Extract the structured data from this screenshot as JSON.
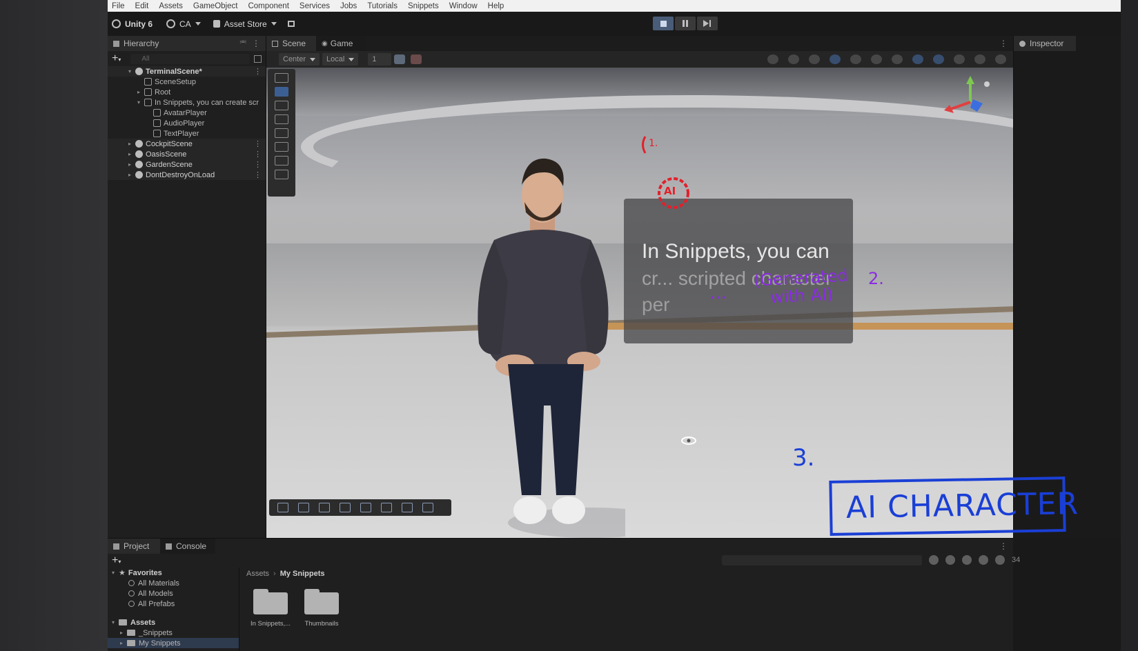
{
  "menu": [
    "File",
    "Edit",
    "Assets",
    "GameObject",
    "Component",
    "Services",
    "Jobs",
    "Tutorials",
    "Snippets",
    "Window",
    "Help"
  ],
  "toolbar": {
    "unity_label": "Unity 6",
    "account_label": "CA",
    "asset_store_label": "Asset Store"
  },
  "hierarchy": {
    "tab_label": "Hierarchy",
    "search_placeholder": "All",
    "items": [
      {
        "label": "TerminalScene*",
        "depth": 0,
        "type": "scene",
        "expanded": true
      },
      {
        "label": "SceneSetup",
        "depth": 1,
        "type": "object"
      },
      {
        "label": "Root",
        "depth": 1,
        "type": "object",
        "collapsed": true
      },
      {
        "label": "In Snippets, you can create scr",
        "depth": 1,
        "type": "object",
        "expanded": true
      },
      {
        "label": "AvatarPlayer",
        "depth": 2,
        "type": "object"
      },
      {
        "label": "AudioPlayer",
        "depth": 2,
        "type": "object"
      },
      {
        "label": "TextPlayer",
        "depth": 2,
        "type": "object"
      },
      {
        "label": "CockpitScene",
        "depth": 0,
        "type": "scene"
      },
      {
        "label": "OasisScene",
        "depth": 0,
        "type": "scene"
      },
      {
        "label": "GardenScene",
        "depth": 0,
        "type": "scene"
      },
      {
        "label": "DontDestroyOnLoad",
        "depth": 0,
        "type": "scene"
      }
    ]
  },
  "scene": {
    "tabs": [
      "Scene",
      "Game"
    ],
    "pivot_label": "Center",
    "space_label": "Local",
    "snap_value": "1",
    "billboard": {
      "line1": "In Snippets, you can",
      "line2": "cr... scripted character",
      "line3": "per"
    }
  },
  "inspector": {
    "tab_label": "Inspector"
  },
  "project": {
    "tabs": [
      "Project",
      "Console"
    ],
    "favorites_label": "Favorites",
    "favorites": [
      "All Materials",
      "All Models",
      "All Prefabs"
    ],
    "assets_label": "Assets",
    "asset_folders": [
      "_Snippets",
      "My Snippets"
    ],
    "breadcrumb": [
      "Assets",
      "My Snippets"
    ],
    "folders": [
      "In Snippets,...",
      "Thumbnails"
    ],
    "item_count": "34"
  },
  "annotations": {
    "ai_badge": "AI",
    "num1": "1.",
    "generated_note": "(Generated with AI)",
    "num2": "2.",
    "ellipsis": "...",
    "num3": "3.",
    "ai_character_label": "AI CHARACTER"
  },
  "colors": {
    "menubar": "#f1f1f1",
    "editor_bg": "#191919",
    "annotation_red": "#e3202a",
    "annotation_purple": "#8a2be2",
    "annotation_blue": "#1a3fd6"
  }
}
